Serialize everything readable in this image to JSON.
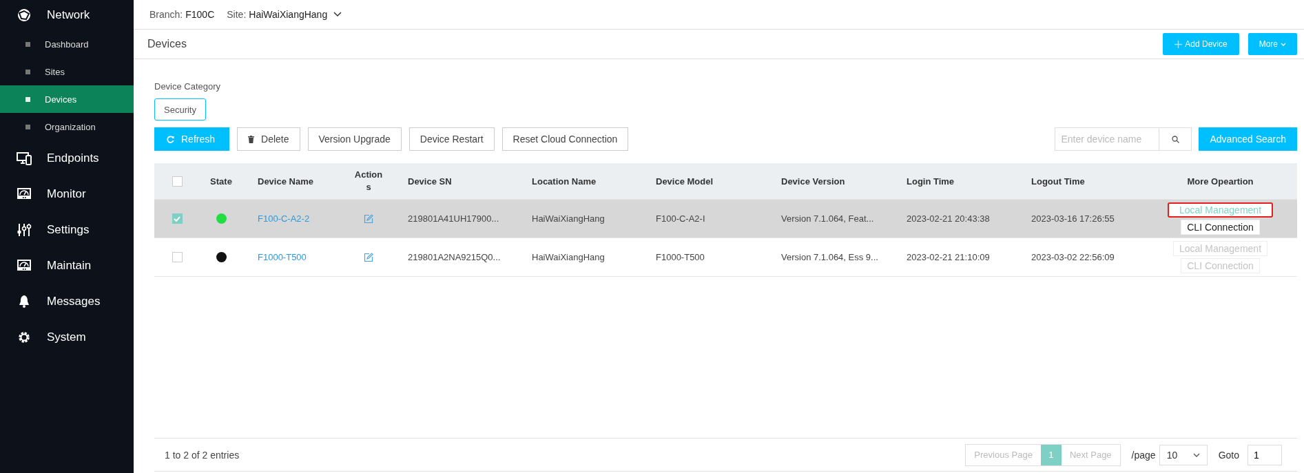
{
  "sidebar": {
    "items": [
      {
        "label": "Network",
        "children": [
          {
            "label": "Dashboard",
            "selected": false
          },
          {
            "label": "Sites",
            "selected": false
          },
          {
            "label": "Devices",
            "selected": true
          },
          {
            "label": "Organization",
            "selected": false
          }
        ]
      },
      {
        "label": "Endpoints"
      },
      {
        "label": "Monitor"
      },
      {
        "label": "Settings"
      },
      {
        "label": "Maintain"
      },
      {
        "label": "Messages"
      },
      {
        "label": "System"
      }
    ]
  },
  "top_bar": {
    "branch_label": "Branch:",
    "branch": "F100C",
    "site_label": "Site:",
    "site": "HaiWaiXiangHang"
  },
  "page_title": "Devices",
  "header_buttons": [
    {
      "label": "Add Device",
      "kind": "add"
    },
    {
      "label": "More",
      "kind": "menu"
    }
  ],
  "category": {
    "label": "Device Category",
    "options": [
      {
        "label": "Security",
        "selected": true
      }
    ]
  },
  "toolbar": {
    "buttons": [
      {
        "label": "Refresh",
        "kind": "refresh"
      },
      {
        "label": "Delete",
        "kind": "delete"
      },
      {
        "label": "Version Upgrade",
        "kind": "plain"
      },
      {
        "label": "Device Restart",
        "kind": "plain"
      },
      {
        "label": "Reset Cloud Connection",
        "kind": "plain"
      }
    ],
    "search": {
      "placeholder": "Enter device name"
    },
    "advanced_search": "Advanced Search"
  },
  "table": {
    "select_all": false,
    "columns": [
      "State",
      "Device Name",
      "Actions",
      "Device SN",
      "Location Name",
      "Device Model",
      "Device Version",
      "Login Time",
      "Logout Time",
      "More Opeartion"
    ],
    "rows": [
      {
        "selected": true,
        "color": "#22dd44",
        "name": "F100-C-A2-2",
        "sn": "219801A41UH17900...",
        "location": "HaiWaiXiangHang",
        "model": "F100-C-A2-I",
        "version": "Version 7.1.064, Feat...",
        "login": "2023-02-21 20:43:38",
        "logout": "2023-03-16 17:26:55",
        "operations": [
          {
            "label": "Local Management",
            "disabled": false,
            "highlighted": true
          },
          {
            "label": "CLI Connection",
            "disabled": false,
            "highlighted": false
          }
        ]
      },
      {
        "selected": false,
        "color": "#111111",
        "name": "F1000-T500",
        "sn": "219801A2NA9215Q0...",
        "location": "HaiWaiXiangHang",
        "model": "F1000-T500",
        "version": "Version 7.1.064, Ess 9...",
        "login": "2023-02-21 21:10:09",
        "logout": "2023-03-02 22:56:09",
        "operations": [
          {
            "label": "Local Management",
            "disabled": true,
            "highlighted": false
          },
          {
            "label": "CLI Connection",
            "disabled": true,
            "highlighted": false
          }
        ]
      }
    ]
  },
  "footer": {
    "summary": "1 to 2 of 2 entries",
    "previous": {
      "label": "Previous Page",
      "disabled": true
    },
    "pages": [
      {
        "label": "1",
        "selected": true
      }
    ],
    "next": {
      "label": "Next Page",
      "disabled": true
    },
    "per_page_label": "/page",
    "per_page": "10",
    "goto_label": "Goto",
    "goto_value": "1"
  }
}
